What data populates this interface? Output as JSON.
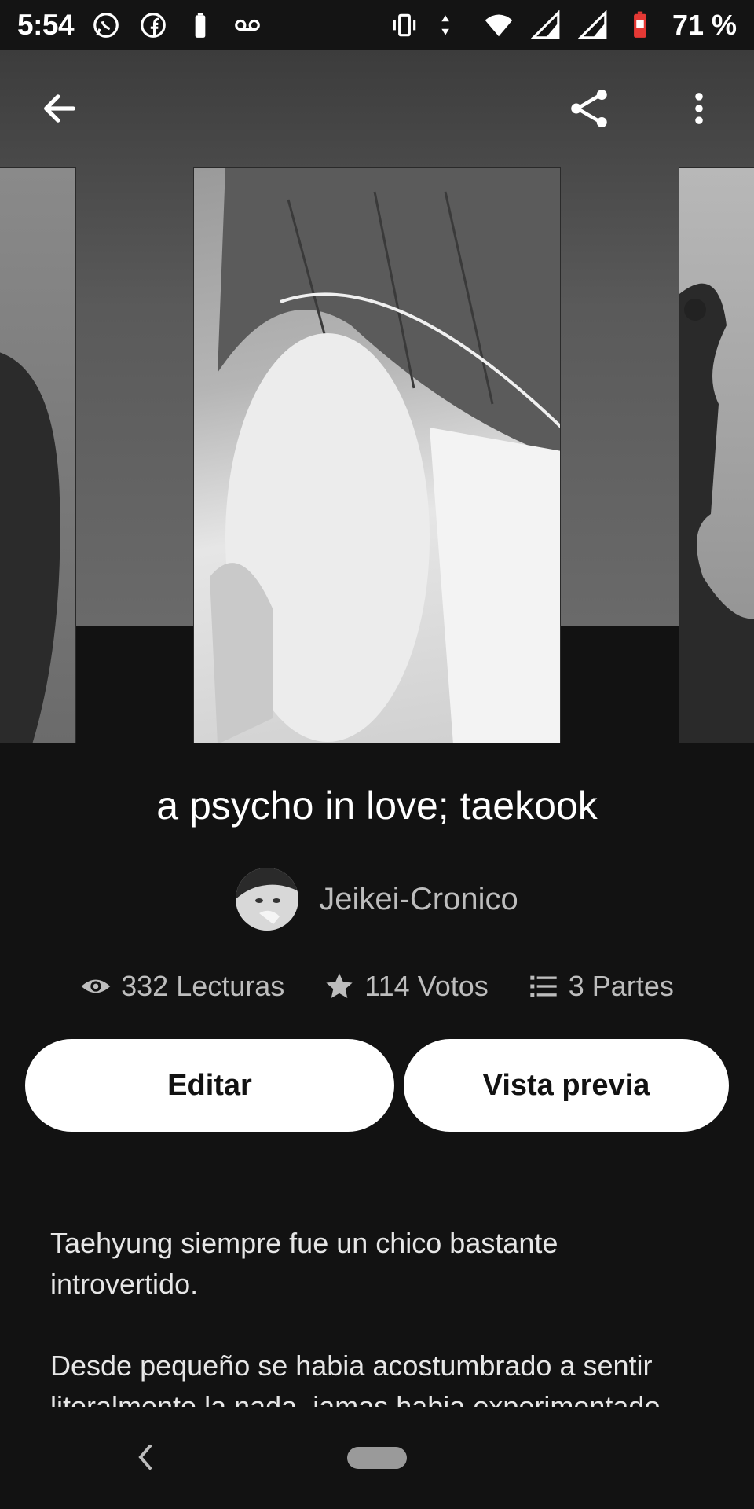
{
  "status_bar": {
    "time": "5:54",
    "battery_percent": "71 %",
    "left_icons": [
      "whatsapp-icon",
      "facebook-icon",
      "battery-saver-icon",
      "voicemail-icon"
    ],
    "right_icons": [
      "vibrate-icon",
      "data-arrows-icon",
      "wifi-icon",
      "signal-icon",
      "signal-icon",
      "battery-charging-icon"
    ]
  },
  "toolbar": {
    "back_icon": "arrow-back-icon",
    "share_icon": "share-icon",
    "more_icon": "more-vert-icon"
  },
  "story": {
    "title": "a psycho in love; taekook",
    "author": "Jeikei-Cronico",
    "stats": {
      "reads": "332 Lecturas",
      "votes": "114 Votos",
      "parts": "3 Partes"
    },
    "edit_label": "Editar",
    "preview_label": "Vista previa",
    "description": [
      "Taehyung siempre fue un chico bastante introvertido.",
      "Desde pequeño se habia acostumbrado a sentir literalmente la nada, jamas habia experimentado"
    ]
  },
  "colors": {
    "background": "#121212",
    "button_bg": "#ffffff",
    "secondary_text": "#bdbdbd"
  }
}
